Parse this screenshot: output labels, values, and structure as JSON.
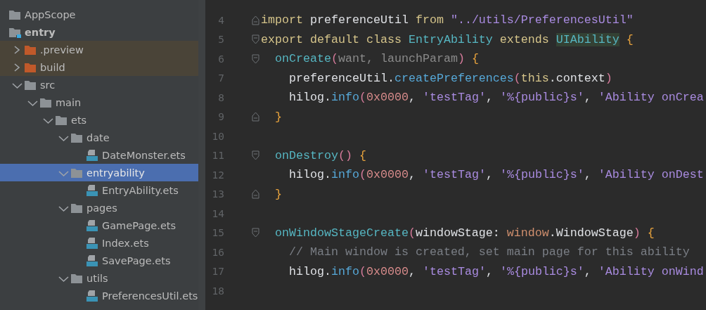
{
  "project_tree": [
    {
      "name": "AppScope",
      "kind": "folder"
    },
    {
      "name": "entry",
      "kind": "module",
      "children": [
        {
          "name": ".preview",
          "kind": "excluded",
          "expanded": false
        },
        {
          "name": "build",
          "kind": "excluded",
          "expanded": false
        },
        {
          "name": "src",
          "kind": "folder",
          "expanded": true,
          "children": [
            {
              "name": "main",
              "kind": "folder",
              "expanded": true,
              "children": [
                {
                  "name": "ets",
                  "kind": "folder",
                  "expanded": true,
                  "children": [
                    {
                      "name": "date",
                      "kind": "folder",
                      "expanded": true,
                      "children": [
                        {
                          "name": "DateMonster.ets",
                          "kind": "file"
                        }
                      ]
                    },
                    {
                      "name": "entryability",
                      "kind": "folder",
                      "expanded": true,
                      "selected": true,
                      "children": [
                        {
                          "name": "EntryAbility.ets",
                          "kind": "file"
                        }
                      ]
                    },
                    {
                      "name": "pages",
                      "kind": "folder",
                      "expanded": true,
                      "children": [
                        {
                          "name": "GamePage.ets",
                          "kind": "file"
                        },
                        {
                          "name": "Index.ets",
                          "kind": "file"
                        },
                        {
                          "name": "SavePage.ets",
                          "kind": "file"
                        }
                      ]
                    },
                    {
                      "name": "utils",
                      "kind": "folder",
                      "expanded": true,
                      "children": [
                        {
                          "name": "PreferencesUtil.ets",
                          "kind": "file"
                        }
                      ]
                    }
                  ]
                }
              ]
            }
          ]
        }
      ]
    }
  ],
  "editor": {
    "lines": [
      {
        "number": "4",
        "fold_start": false,
        "fold_end": true,
        "tokens": [
          {
            "text": "import ",
            "kind": "keyword"
          },
          {
            "text": "preferenceUtil ",
            "kind": "plain"
          },
          {
            "text": "from ",
            "kind": "keyword"
          },
          {
            "text": "\"../utils/PreferencesUtil\"",
            "kind": "string"
          }
        ]
      },
      {
        "number": "5",
        "fold_start": true,
        "fold_end": false,
        "tokens": [
          {
            "text": "export default class ",
            "kind": "keyword"
          },
          {
            "text": "EntryAbility ",
            "kind": "class"
          },
          {
            "text": "extends ",
            "kind": "keyword"
          },
          {
            "text": "UIAbility",
            "kind": "match"
          },
          {
            "text": " {",
            "kind": "brace"
          }
        ]
      },
      {
        "number": "6",
        "fold_start": true,
        "fold_end": false,
        "tokens": [
          {
            "text": "  onCreate",
            "kind": "method"
          },
          {
            "text": "(",
            "kind": "paren"
          },
          {
            "text": "want, launchParam",
            "kind": "param"
          },
          {
            "text": ")",
            "kind": "paren"
          },
          {
            "text": " {",
            "kind": "brace"
          }
        ]
      },
      {
        "number": "7",
        "fold_start": false,
        "fold_end": false,
        "tokens": [
          {
            "text": "    preferenceUtil.",
            "kind": "plain"
          },
          {
            "text": "createPreferences",
            "kind": "call"
          },
          {
            "text": "(",
            "kind": "paren"
          },
          {
            "text": "this",
            "kind": "keyword"
          },
          {
            "text": ".context",
            "kind": "plain"
          },
          {
            "text": ")",
            "kind": "paren"
          }
        ]
      },
      {
        "number": "8",
        "fold_start": false,
        "fold_end": false,
        "tokens": [
          {
            "text": "    hilog.",
            "kind": "plain"
          },
          {
            "text": "info",
            "kind": "call"
          },
          {
            "text": "(",
            "kind": "paren"
          },
          {
            "text": "0x0000",
            "kind": "number"
          },
          {
            "text": ", ",
            "kind": "plain"
          },
          {
            "text": "'testTag'",
            "kind": "string"
          },
          {
            "text": ", ",
            "kind": "plain"
          },
          {
            "text": "'%{public}s'",
            "kind": "string"
          },
          {
            "text": ", ",
            "kind": "plain"
          },
          {
            "text": "'Ability onCrea",
            "kind": "string"
          }
        ]
      },
      {
        "number": "9",
        "fold_start": false,
        "fold_end": true,
        "tokens": [
          {
            "text": "  }",
            "kind": "brace"
          }
        ]
      },
      {
        "number": "10",
        "fold_start": false,
        "fold_end": false
      },
      {
        "number": "11",
        "fold_start": true,
        "fold_end": false,
        "tokens": [
          {
            "text": "  onDestroy",
            "kind": "method"
          },
          {
            "text": "()",
            "kind": "paren"
          },
          {
            "text": " {",
            "kind": "brace"
          }
        ]
      },
      {
        "number": "12",
        "fold_start": false,
        "fold_end": false,
        "tokens": [
          {
            "text": "    hilog.",
            "kind": "plain"
          },
          {
            "text": "info",
            "kind": "call"
          },
          {
            "text": "(",
            "kind": "paren"
          },
          {
            "text": "0x0000",
            "kind": "number"
          },
          {
            "text": ", ",
            "kind": "plain"
          },
          {
            "text": "'testTag'",
            "kind": "string"
          },
          {
            "text": ", ",
            "kind": "plain"
          },
          {
            "text": "'%{public}s'",
            "kind": "string"
          },
          {
            "text": ", ",
            "kind": "plain"
          },
          {
            "text": "'Ability onDest",
            "kind": "string"
          }
        ]
      },
      {
        "number": "13",
        "fold_start": false,
        "fold_end": true,
        "tokens": [
          {
            "text": "  }",
            "kind": "brace"
          }
        ]
      },
      {
        "number": "14",
        "fold_start": false,
        "fold_end": false
      },
      {
        "number": "15",
        "fold_start": true,
        "fold_end": false,
        "tokens": [
          {
            "text": "  onWindowStageCreate",
            "kind": "method"
          },
          {
            "text": "(",
            "kind": "paren"
          },
          {
            "text": "windowStage: ",
            "kind": "plain"
          },
          {
            "text": "window",
            "kind": "namespace"
          },
          {
            "text": ".WindowStage",
            "kind": "plain"
          },
          {
            "text": ")",
            "kind": "paren"
          },
          {
            "text": " {",
            "kind": "brace"
          }
        ]
      },
      {
        "number": "16",
        "fold_start": false,
        "fold_end": false,
        "tokens": [
          {
            "text": "    // Main window is created, set main page for this ability",
            "kind": "comment"
          }
        ]
      },
      {
        "number": "17",
        "fold_start": false,
        "fold_end": false,
        "tokens": [
          {
            "text": "    hilog.",
            "kind": "plain"
          },
          {
            "text": "info",
            "kind": "call"
          },
          {
            "text": "(",
            "kind": "paren"
          },
          {
            "text": "0x0000",
            "kind": "number"
          },
          {
            "text": ", ",
            "kind": "plain"
          },
          {
            "text": "'testTag'",
            "kind": "string"
          },
          {
            "text": ", ",
            "kind": "plain"
          },
          {
            "text": "'%{public}s'",
            "kind": "string"
          },
          {
            "text": ", ",
            "kind": "plain"
          },
          {
            "text": "'Ability onWind",
            "kind": "string"
          }
        ]
      },
      {
        "number": "18",
        "fold_start": false,
        "fold_end": false
      }
    ]
  }
}
